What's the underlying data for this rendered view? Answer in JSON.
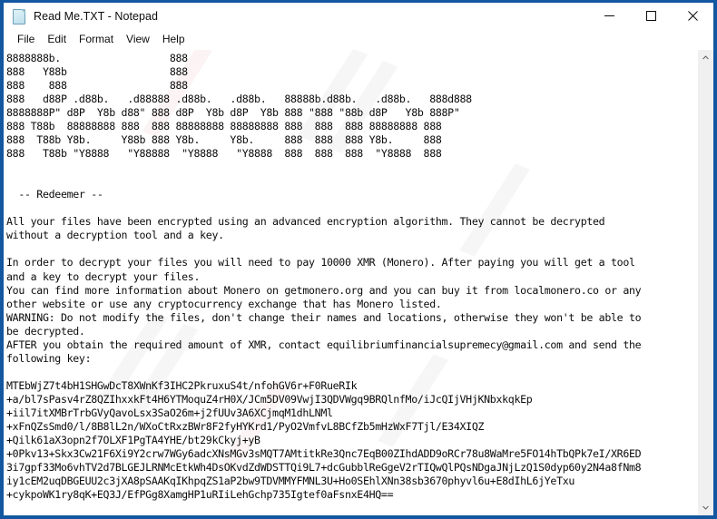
{
  "window": {
    "title": "Read Me.TXT - Notepad",
    "icon": "notepad-document-icon",
    "border_color": "#1257a0",
    "controls": {
      "minimize": "Minimize",
      "maximize": "Maximize",
      "close": "Close"
    }
  },
  "menu": {
    "items": [
      {
        "label": "File"
      },
      {
        "label": "Edit"
      },
      {
        "label": "Format"
      },
      {
        "label": "View"
      },
      {
        "label": "Help"
      }
    ]
  },
  "scrollbar": {
    "up_arrow": "▲",
    "down_arrow": "▼"
  },
  "document": {
    "ascii_art": [
      "8888888b.                  888",
      "888   Y88b                 888",
      "888    888                 888",
      "888   d88P .d88b.   .d88888 .d88b.   .d88b.   88888b.d88b.   .d88b.   888d888",
      "8888888P\" d8P  Y8b d88\" 888 d8P  Y8b d8P  Y8b 888 \"888 \"88b d8P   Y8b 888P\"",
      "888 T88b  88888888 888  888 88888888 88888888 888  888  888 88888888 888",
      "888  T88b Y8b.     Y88b 888 Y8b.     Y8b.     888  888  888 Y8b.     888",
      "888   T88b \"Y8888   \"Y88888  \"Y8888   \"Y8888  888  888  888  \"Y8888  888"
    ],
    "header": "  -- Redeemer --",
    "paragraphs": [
      "All your files have been encrypted using an advanced encryption algorithm. They cannot be decrypted",
      "without a decryption tool and a key.",
      "",
      "In order to decrypt your files you will need to pay 10000 XMR (Monero). After paying you will get a tool",
      "and a key to decrypt your files.",
      "You can find more information about Monero on getmonero.org and you can buy it from localmonero.co or any",
      "other website or use any cryptocurrency exchange that has Monero listed.",
      "WARNING: Do not modify the files, don't change their names and locations, otherwise they won't be able to",
      "be decrypted.",
      "AFTER you obtain the required amount of XMR, contact equilibriumfinancialsupremecy@gmail.com and send the",
      "following key:"
    ],
    "ransom_amount": "10000 XMR (Monero)",
    "contact_email": "equilibriumfinancialsupremecy@gmail.com",
    "monero_sites": [
      "getmonero.org",
      "localmonero.co"
    ],
    "key_lines": [
      "MTEbWjZ7t4bH1SHGwDcT8XWnKf3IHC2PkruxuS4t/nfohGV6r+F0RueRIk",
      "+a/bl7sPasv4rZ8QZIhxxkFt4H6YTMoquZ4rH0X/JCm5DV09VwjI3QDVWgq9BRQlnfMo/iJcQIjVHjKNbxkqkEp",
      "+iil7itXMBrTrbGVyQavoLsx3SaO26m+j2fUUv3A6XCjmqM1dhLNMl",
      "+xFnQZsSmd0/l/8B8lL2n/WXoCtRxzBWr8F2fyHYKrd1/PyO2VmfvL8BCfZb5mHzWxF7Tjl/E34XIQZ",
      "+Qilk61aX3opn2f7OLXF1PgTA4YHE/bt29kCkyj+yB",
      "+0Pkv13+Skx3Cw21F6Xi9Y2crw7WGy6adcXNsMGv3sMQT7AMtitkRe3Qnc7EqB00ZIhdADD9oRCr78u8WaMre5FO14hTbQPk7eI/XR6ED",
      "3i7gpf33Mo6vhTV2d7BLGEJLRNMcEtkWh4DsOKvdZdWDSTTQi9L7+dcGubblReGgeV2rTIQwQlPQsNDgaJNjLzQ1S0dyp60y2N4a8fNm8",
      "iy1cEM2uqDBGEUU2c3jXA8pSAAKqIKhpqZS1aP2bw9TDVMMYFMNL3U+Ho0SEhlXNn38sb3670phyvl6u+E8dIhL6jYeTxu",
      "+cykpoWK1ry8qK+EQ3J/EfPGg8XamgHP1uRIiLehGchp735Igtef0aFsnxE4HQ=="
    ]
  }
}
